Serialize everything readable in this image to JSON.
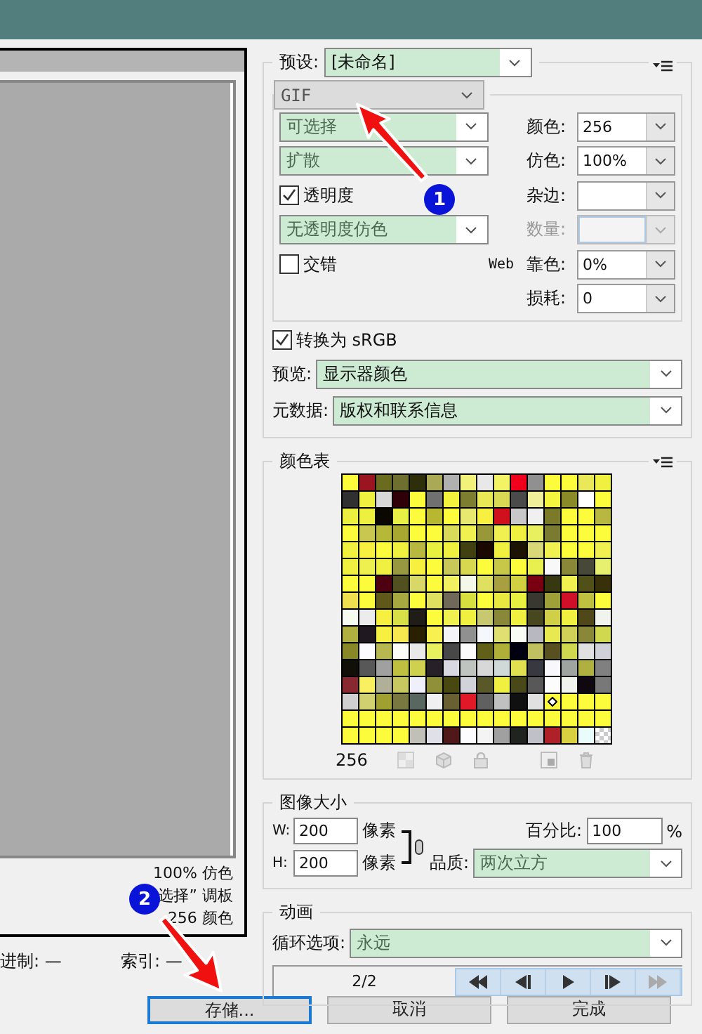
{
  "preview": {
    "info_lines": [
      "100% 仿色",
      "选择” 调板",
      "256 颜色"
    ],
    "status": [
      {
        "label": "进制:",
        "value": "—"
      },
      {
        "label": "索引:",
        "value": "—"
      }
    ]
  },
  "preset": {
    "label": "预设:",
    "value": "[未命名]"
  },
  "format": {
    "value": "GIF"
  },
  "settings_left": [
    {
      "kind": "select",
      "value": "可选择"
    },
    {
      "kind": "select",
      "value": "扩散"
    },
    {
      "kind": "checkbox",
      "label": "透明度",
      "checked": true
    },
    {
      "kind": "select",
      "value": "无透明度仿色"
    },
    {
      "kind": "checkbox",
      "label": "交错",
      "checked": false
    }
  ],
  "settings_right": [
    {
      "label": "颜色:",
      "value": "256",
      "disabled": false
    },
    {
      "label": "仿色:",
      "value": "100%",
      "disabled": false
    },
    {
      "label": "杂边:",
      "disabled": false
    },
    {
      "label": "数量:",
      "disabled": true
    },
    {
      "prefix": "Web",
      "label": "靠色:",
      "value": "0%",
      "disabled": false
    },
    {
      "label": "损耗:",
      "value": "0",
      "disabled": false
    }
  ],
  "convert_srgb": {
    "label": "转换为 sRGB",
    "checked": true
  },
  "preview_select": {
    "label": "预览:",
    "value": "显示器颜色"
  },
  "metadata": {
    "label": "元数据:",
    "value": "版权和联系信息"
  },
  "color_table": {
    "title": "颜色表",
    "count": "256",
    "rows": [
      [
        {
          "color": "#fcfc3c"
        },
        {
          "color": "#9a1520"
        },
        {
          "color": "#6b6b1f"
        },
        {
          "color": "#6e6e2e"
        },
        {
          "color": "#2f2e0a"
        },
        {
          "color": "#aaa955"
        },
        {
          "color": "#b0b0b0"
        },
        {
          "color": "#f2f27a"
        },
        {
          "color": "#e8e8e8"
        },
        {
          "color": "#f3f365"
        },
        {
          "color": "#f0001c"
        },
        {
          "color": "#909090"
        },
        {
          "color": "#fcfc3c"
        },
        {
          "color": "#fcfc3c"
        },
        {
          "color": "#e8e858"
        },
        {
          "color": "#f0f040"
        }
      ],
      [
        {
          "color": "#303030"
        },
        {
          "color": "#f0f040"
        },
        {
          "color": "#d8d8d8"
        },
        {
          "color": "#300008"
        },
        {
          "color": "#fcfc3c"
        },
        {
          "color": "#707070"
        },
        {
          "color": "#f3f33d"
        },
        {
          "color": "#7e7e30"
        },
        {
          "color": "#e9e955"
        },
        {
          "color": "#dada55"
        },
        {
          "color": "#4a4a4a"
        },
        {
          "color": "#f0f09a"
        },
        {
          "color": "#f5f540"
        },
        {
          "color": "#8a8a28"
        },
        {
          "color": "#ffffff"
        },
        {
          "color": "#fcfc3c"
        }
      ],
      [
        {
          "color": "#ebf040"
        },
        {
          "color": "#eef040"
        },
        {
          "color": "#0a0800"
        },
        {
          "color": "#e8f045"
        },
        {
          "color": "#fcfc3c"
        },
        {
          "color": "#b8b830"
        },
        {
          "color": "#fcfc3c"
        },
        {
          "color": "#e8e870"
        },
        {
          "color": "#f8f040"
        },
        {
          "color": "#d0101c"
        },
        {
          "color": "#c8c8c8"
        },
        {
          "color": "#f0f0f0"
        },
        {
          "color": "#7a7a28"
        },
        {
          "color": "#fcfc3c"
        },
        {
          "color": "#fcfc3c"
        },
        {
          "color": "#b8b840"
        }
      ],
      [
        {
          "color": "#fcfc3c"
        },
        {
          "color": "#c8c850"
        },
        {
          "color": "#b8b838"
        },
        {
          "color": "#a8a830"
        },
        {
          "color": "#fcfc3c"
        },
        {
          "color": "#fcfc3c"
        },
        {
          "color": "#dada5a"
        },
        {
          "color": "#f0f050"
        },
        {
          "color": "#989838"
        },
        {
          "color": "#f0f050"
        },
        {
          "color": "#f0f040"
        },
        {
          "color": "#e8f060"
        },
        {
          "color": "#7a7a30"
        },
        {
          "color": "#fcfc3c"
        },
        {
          "color": "#fcfc3c"
        },
        {
          "color": "#fcfc3c"
        }
      ],
      [
        {
          "color": "#f0f040"
        },
        {
          "color": "#f8f040"
        },
        {
          "color": "#fcfc3c"
        },
        {
          "color": "#f0f040"
        },
        {
          "color": "#b8b840"
        },
        {
          "color": "#e8f040"
        },
        {
          "color": "#f0f040"
        },
        {
          "color": "#404010"
        },
        {
          "color": "#180800"
        },
        {
          "color": "#f0f040"
        },
        {
          "color": "#1c1400"
        },
        {
          "color": "#d8d878"
        },
        {
          "color": "#f0f050"
        },
        {
          "color": "#fcfc3c"
        },
        {
          "color": "#fcfc3c"
        },
        {
          "color": "#f0f050"
        }
      ],
      [
        {
          "color": "#f0f040"
        },
        {
          "color": "#eef050"
        },
        {
          "color": "#f0f040"
        },
        {
          "color": "#989840"
        },
        {
          "color": "#f8f040"
        },
        {
          "color": "#fcfc3c"
        },
        {
          "color": "#c8c858"
        },
        {
          "color": "#d8d850"
        },
        {
          "color": "#fcfc3c"
        },
        {
          "color": "#c8c848"
        },
        {
          "color": "#fcfc3c"
        },
        {
          "color": "#e8f050"
        },
        {
          "color": "#f8f8f8"
        },
        {
          "color": "#888838"
        },
        {
          "color": "#484838"
        },
        {
          "color": "#e8f070"
        }
      ],
      [
        {
          "color": "#fcfc3c"
        },
        {
          "color": "#fcfc3c"
        },
        {
          "color": "#4c0010"
        },
        {
          "color": "#505020"
        },
        {
          "color": "#d8d868"
        },
        {
          "color": "#fcfc3c"
        },
        {
          "color": "#f0f060"
        },
        {
          "color": "#f4f8e8"
        },
        {
          "color": "#e0e060"
        },
        {
          "color": "#a8a040"
        },
        {
          "color": "#d0d040"
        },
        {
          "color": "#780010"
        },
        {
          "color": "#383810"
        },
        {
          "color": "#f0f050"
        },
        {
          "color": "#505018"
        },
        {
          "color": "#383008"
        }
      ],
      [
        {
          "color": "#f0e050"
        },
        {
          "color": "#fcfc3c"
        },
        {
          "color": "#605818"
        },
        {
          "color": "#a8a840"
        },
        {
          "color": "#fcfc3c"
        },
        {
          "color": "#e0e060"
        },
        {
          "color": "#706858"
        },
        {
          "color": "#d8e040"
        },
        {
          "color": "#fcfc3c"
        },
        {
          "color": "#e8e840"
        },
        {
          "color": "#e8f040"
        },
        {
          "color": "#383830"
        },
        {
          "color": "#a0a038"
        },
        {
          "color": "#d01028"
        },
        {
          "color": "#c0c040"
        },
        {
          "color": "#fcfc3c"
        }
      ],
      [
        {
          "color": "#f8fbf0"
        },
        {
          "color": "#ececec"
        },
        {
          "color": "#f8f040"
        },
        {
          "color": "#d8e048"
        },
        {
          "color": "#201c18"
        },
        {
          "color": "#fcfc3c"
        },
        {
          "color": "#f0f050"
        },
        {
          "color": "#f0f040"
        },
        {
          "color": "#c8c870"
        },
        {
          "color": "#888838"
        },
        {
          "color": "#f0f040"
        },
        {
          "color": "#484820"
        },
        {
          "color": "#d0d048"
        },
        {
          "color": "#f0f040"
        },
        {
          "color": "#504818"
        },
        {
          "color": "#f0f4ec"
        }
      ],
      [
        {
          "color": "#b0b040"
        },
        {
          "color": "#201820"
        },
        {
          "color": "#f8f040"
        },
        {
          "color": "#f8e850"
        },
        {
          "color": "#282000"
        },
        {
          "color": "#f8f050"
        },
        {
          "color": "#f4f4f8"
        },
        {
          "color": "#909090"
        },
        {
          "color": "#f4f8fc"
        },
        {
          "color": "#e0e070"
        },
        {
          "color": "#f8fcf4"
        },
        {
          "color": "#b8b8c0"
        },
        {
          "color": "#e8e850"
        },
        {
          "color": "#d0d058"
        },
        {
          "color": "#888838"
        },
        {
          "color": "#d0d850"
        }
      ],
      [
        {
          "color": "#888828"
        },
        {
          "color": "#fcfcff"
        },
        {
          "color": "#b8b850"
        },
        {
          "color": "#fcfcf8"
        },
        {
          "color": "#e8e8e8"
        },
        {
          "color": "#e8f060"
        },
        {
          "color": "#484848"
        },
        {
          "color": "#fcfcfc"
        },
        {
          "color": "#606018"
        },
        {
          "color": "#b0b038"
        },
        {
          "color": "#000010"
        },
        {
          "color": "#c0c060"
        },
        {
          "color": "#585020"
        },
        {
          "color": "#d0d850"
        },
        {
          "color": "#e0e0e0"
        },
        {
          "color": "#d0d0d8"
        }
      ],
      [
        {
          "color": "#101008"
        },
        {
          "color": "#585858"
        },
        {
          "color": "#a0a0a0"
        },
        {
          "color": "#c0c040"
        },
        {
          "color": "#d0d050"
        },
        {
          "color": "#282028"
        },
        {
          "color": "#d8d8e0"
        },
        {
          "color": "#c0c4c0"
        },
        {
          "color": "#d8d8d8"
        },
        {
          "color": "#d0d8d8"
        },
        {
          "color": "#e0e050"
        },
        {
          "color": "#383840"
        },
        {
          "color": "#f8f8fc"
        },
        {
          "color": "#a0a4a0"
        },
        {
          "color": "#b0b040"
        },
        {
          "color": "#808080"
        }
      ],
      [
        {
          "color": "#882830"
        },
        {
          "color": "#f8f060"
        },
        {
          "color": "#b0b098"
        },
        {
          "color": "#c8c860"
        },
        {
          "color": "#f0f0fc"
        },
        {
          "color": "#909038"
        },
        {
          "color": "#484810"
        },
        {
          "color": "#d0d4d8"
        },
        {
          "color": "#585828"
        },
        {
          "color": "#f0f040"
        },
        {
          "color": "#484818"
        },
        {
          "color": "#585858"
        },
        {
          "color": "#fcfcfc"
        },
        {
          "color": "#f0f4ec"
        },
        {
          "color": "#100810"
        },
        {
          "color": "#787878"
        }
      ],
      [
        {
          "color": "#d0d0d0"
        },
        {
          "color": "#d0d070"
        },
        {
          "color": "#a0a030"
        },
        {
          "color": "#787840"
        },
        {
          "color": "#586860"
        },
        {
          "color": "#f0f0f0"
        },
        {
          "color": "#686030"
        },
        {
          "color": "#e01828"
        },
        {
          "color": "#606060"
        },
        {
          "color": "#c0c0c0"
        },
        {
          "color": "#101010"
        },
        {
          "color": "#e0e0e0"
        },
        {
          "color": "#fcfc3c",
          "selected": true
        },
        {
          "color": "#fcfc3c"
        },
        {
          "color": "#fcfc3c"
        },
        {
          "color": "#fcfc3c"
        }
      ],
      [
        {
          "color": "#fcfc3c"
        },
        {
          "color": "#fcfc3c"
        },
        {
          "color": "#fcfc3c"
        },
        {
          "color": "#fcfc3c"
        },
        {
          "color": "#fcfc3c"
        },
        {
          "color": "#fcfc3c"
        },
        {
          "color": "#fcfc3c"
        },
        {
          "color": "#fcfc3c"
        },
        {
          "color": "#fcfc3c"
        },
        {
          "color": "#fcfc3c"
        },
        {
          "color": "#fcfc3c"
        },
        {
          "color": "#fcfc3c"
        },
        {
          "color": "#fcfc3c"
        },
        {
          "color": "#fcfc3c"
        },
        {
          "color": "#fcfc3c"
        },
        {
          "color": "#fcfc3c"
        }
      ],
      [
        {
          "color": "#fcfc3c"
        },
        {
          "color": "#fcfc3c"
        },
        {
          "color": "#fcfc3c"
        },
        {
          "color": "#fcfc3c"
        },
        {
          "color": "#c0c0b8"
        },
        {
          "color": "#e0e0e8"
        },
        {
          "color": "#501818"
        },
        {
          "color": "#fcfcff"
        },
        {
          "color": "#f4f4f4"
        },
        {
          "color": "#a0a0a0"
        },
        {
          "color": "#202420"
        },
        {
          "color": "#c0c0c8"
        },
        {
          "color": "#b02028"
        },
        {
          "color": "#d8d040"
        },
        {
          "color": "#e8fcfc"
        },
        {
          "color": "#ffffff",
          "transparent": true
        }
      ]
    ]
  },
  "image_size": {
    "title": "图像大小",
    "width": {
      "label": "W:",
      "value": "200",
      "unit": "像素"
    },
    "height": {
      "label": "H:",
      "value": "200",
      "unit": "像素"
    },
    "percent": {
      "label": "百分比:",
      "value": "100",
      "unit": "%"
    },
    "quality": {
      "label": "品质:",
      "value": "两次立方"
    }
  },
  "animation": {
    "title": "动画",
    "loop": {
      "label": "循环选项:",
      "value": "永远"
    },
    "frame": "2/2"
  },
  "buttons": [
    {
      "label": "存储...",
      "focused": true
    },
    {
      "label": "取消",
      "focused": false
    },
    {
      "label": "完成",
      "focused": false
    }
  ],
  "annotations": [
    {
      "number": "1"
    },
    {
      "number": "2"
    }
  ]
}
